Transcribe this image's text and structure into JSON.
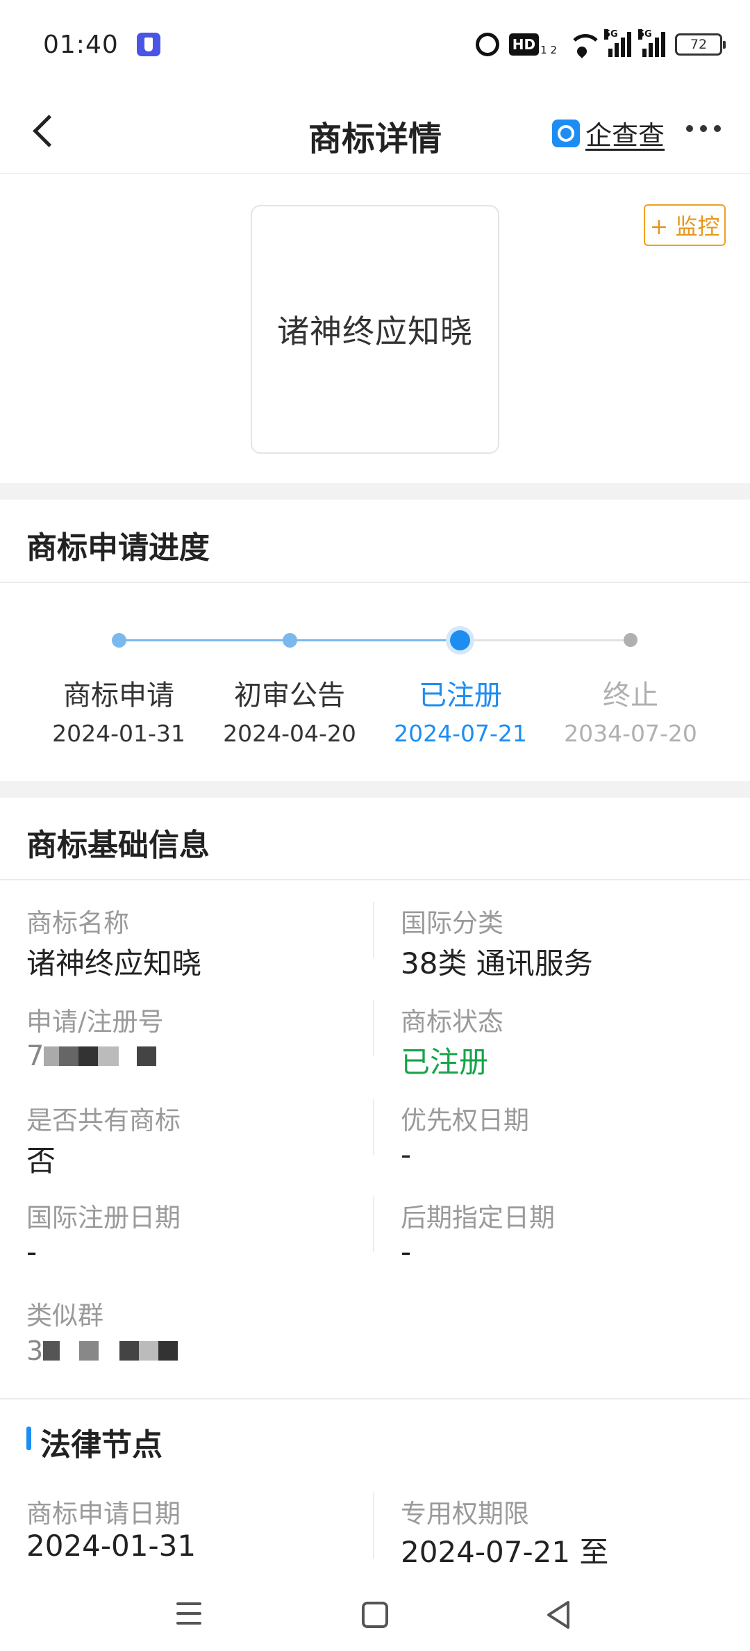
{
  "status_bar": {
    "time": "01:40",
    "hd_label": "HD",
    "hd_sup": "1 2",
    "signal_tag_1": "5G",
    "signal_tag_2": "5G",
    "battery": "72"
  },
  "header": {
    "title": "商标详情",
    "brand_name": "企查查"
  },
  "trademark": {
    "image_text": "诸神终应知晓",
    "monitor_label": "+ 监控"
  },
  "progress": {
    "title": "商标申请进度",
    "steps": [
      {
        "label": "商标申请",
        "date": "2024-01-31",
        "state": "done"
      },
      {
        "label": "初审公告",
        "date": "2024-04-20",
        "state": "done"
      },
      {
        "label": "已注册",
        "date": "2024-07-21",
        "state": "current"
      },
      {
        "label": "终止",
        "date": "2034-07-20",
        "state": "future"
      }
    ]
  },
  "basic_info": {
    "title": "商标基础信息",
    "fields": {
      "name_label": "商标名称",
      "name_value": "诸神终应知晓",
      "intl_class_label": "国际分类",
      "intl_class_value": "38类 通讯服务",
      "reg_no_label": "申请/注册号",
      "reg_no_prefix": "7",
      "status_label": "商标状态",
      "status_value": "已注册",
      "shared_label": "是否共有商标",
      "shared_value": "否",
      "priority_label": "优先权日期",
      "priority_value": "-",
      "intl_reg_date_label": "国际注册日期",
      "intl_reg_date_value": "-",
      "later_date_label": "后期指定日期",
      "later_date_value": "-",
      "similar_group_label": "类似群",
      "similar_group_prefix": "3"
    }
  },
  "legal": {
    "title": "法律节点",
    "apply_date_label": "商标申请日期",
    "apply_date_value": "2024-01-31",
    "exclusive_label": "专用权期限",
    "exclusive_value": "2024-07-21 至"
  },
  "colors": {
    "accent_blue": "#1e8df2",
    "done_blue": "#7ab8ee",
    "status_green": "#16a34a",
    "monitor_orange": "#e8961a",
    "future_gray": "#b0b0b0"
  }
}
